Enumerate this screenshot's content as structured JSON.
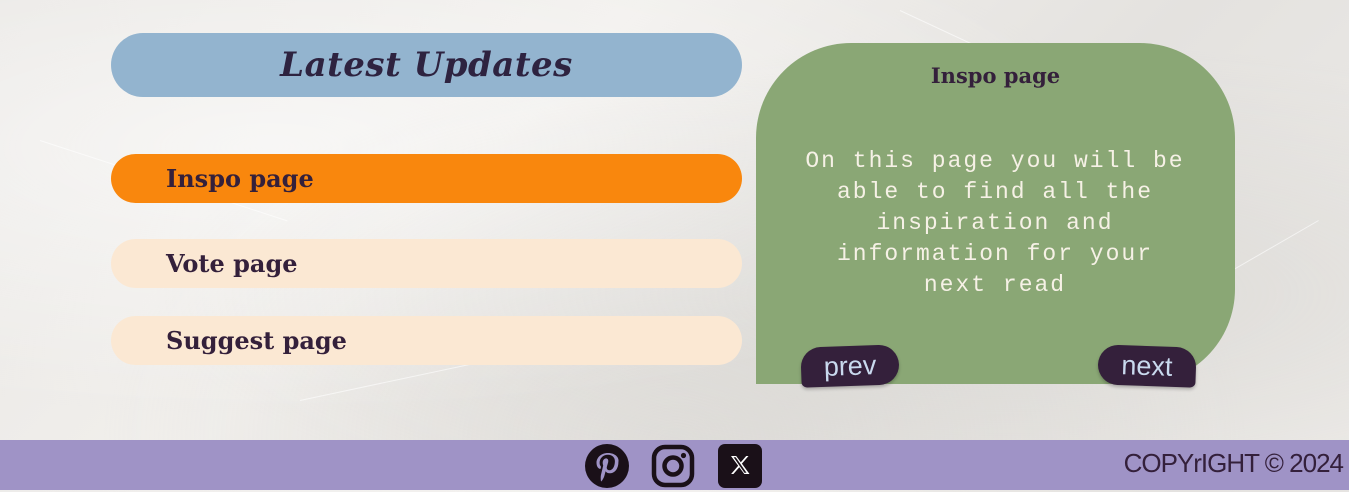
{
  "updates": {
    "title": "Latest Updates"
  },
  "nav": {
    "items": [
      {
        "label": "Inspo page",
        "active": true
      },
      {
        "label": "Vote page",
        "active": false
      },
      {
        "label": "Suggest page",
        "active": false
      }
    ]
  },
  "card": {
    "title": "Inspo page",
    "body": "On this page you will be able to find all the inspiration and information for your next read",
    "prev_label": "prev",
    "next_label": "next"
  },
  "footer": {
    "social_icons": [
      "pinterest-icon",
      "instagram-icon",
      "x-icon"
    ],
    "copyright": "COPYrIGHT © 2024"
  },
  "colors": {
    "header_blue": "#93b4cf",
    "active_orange": "#f9870d",
    "inactive_cream": "#fbe8d3",
    "card_green": "#8aa775",
    "dark_purple": "#34203b",
    "footer_lavender": "#9f93c6"
  }
}
